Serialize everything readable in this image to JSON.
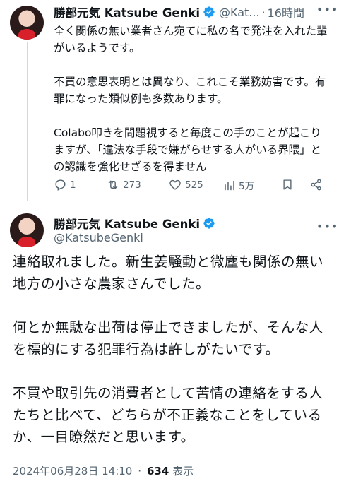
{
  "tweet1": {
    "display_name": "勝部元気 Katsube Genki",
    "handle": "@Kat...",
    "separator": "·",
    "time": "16時間",
    "text": "全く関係の無い業者さん宛てに私の名で発注を入れた輩がいるようです。\n\n不買の意思表明とは異なり、これこそ業務妨害です。有罪になった類似例も多数あります。\n\nColabo叩きを問題視すると毎度この手のことが起こりますが、「違法な手段で嫌がらせする人がいる界隈」との認識を強化せざるを得ません",
    "actions": {
      "reply_count": "1",
      "retweet_count": "273",
      "like_count": "525",
      "views_count": "5万"
    }
  },
  "tweet2": {
    "display_name": "勝部元気 Katsube Genki",
    "handle": "@KatsubeGenki",
    "text": "連絡取れました。新生姜騒動と微塵も関係の無い地方の小さな農家さんでした。\n\n何とか無駄な出荷は停止できましたが、そんな人を標的にする犯罪行為は許しがたいです。\n\n不買や取引先の消費者として苦情の連絡をする人たちと比べて、どちらが不正義なことをしているか、一目瞭然だと思います。",
    "timestamp": "2024年06月28日 14:10",
    "separator": "·",
    "views_count": "634",
    "views_label": "表示"
  },
  "icons": {
    "verified": "verified-badge-icon",
    "more": "more-icon",
    "reply": "reply-icon",
    "retweet": "retweet-icon",
    "like": "heart-icon",
    "views": "views-icon",
    "bookmark": "bookmark-icon",
    "share": "share-icon"
  },
  "colors": {
    "verified": "#1d9bf0",
    "secondary_text": "#536471",
    "primary_text": "#0f1419"
  }
}
